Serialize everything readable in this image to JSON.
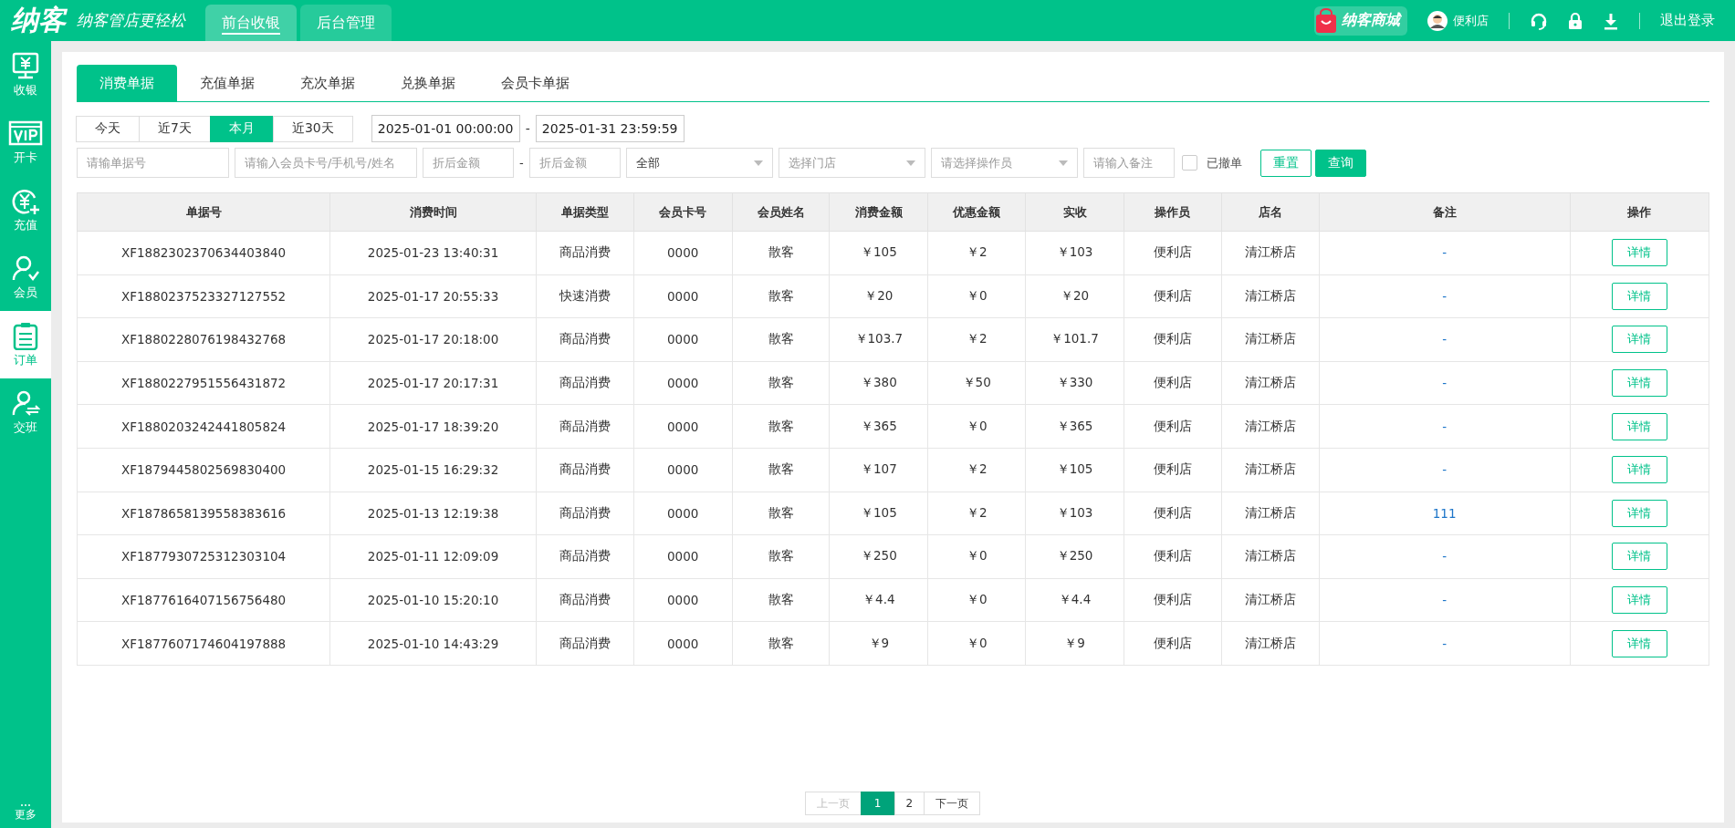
{
  "header": {
    "logo": "纳客",
    "slogan": "纳客管店更轻松",
    "nav_tabs": [
      {
        "label": "前台收银",
        "selected": true
      },
      {
        "label": "后台管理",
        "selected": false
      }
    ],
    "mall": "纳客商城",
    "user": "便利店",
    "logout": "退出登录"
  },
  "sidebar": {
    "items": [
      {
        "label": "收银",
        "kind": "cashier",
        "selected": false
      },
      {
        "label": "开卡",
        "kind": "vip",
        "selected": false
      },
      {
        "label": "充值",
        "kind": "recharge",
        "selected": false
      },
      {
        "label": "会员",
        "kind": "member",
        "selected": false
      },
      {
        "label": "订单",
        "kind": "order",
        "selected": true
      },
      {
        "label": "交班",
        "kind": "shift",
        "selected": false
      }
    ],
    "more": "更多"
  },
  "tabs": [
    {
      "label": "消费单据",
      "selected": true
    },
    {
      "label": "充值单据",
      "selected": false
    },
    {
      "label": "充次单据",
      "selected": false
    },
    {
      "label": "兑换单据",
      "selected": false
    },
    {
      "label": "会员卡单据",
      "selected": false
    }
  ],
  "date_presets": [
    {
      "label": "今天",
      "selected": false
    },
    {
      "label": "近7天",
      "selected": false
    },
    {
      "label": "本月",
      "selected": true
    },
    {
      "label": "近30天",
      "selected": false
    }
  ],
  "date_from": "2025-01-01 00:00:00",
  "date_sep": "-",
  "date_to": "2025-01-31 23:59:59",
  "filters": {
    "order_no": {
      "placeholder": "请输单据号"
    },
    "member": {
      "placeholder": "请输入会员卡号/手机号/姓名"
    },
    "amount_min": {
      "placeholder": "折后金额"
    },
    "amount_sep": "-",
    "amount_max": {
      "placeholder": "折后金额"
    },
    "type": {
      "value": "全部"
    },
    "store": {
      "placeholder": "选择门店"
    },
    "operator": {
      "placeholder": "请选择操作员"
    },
    "remark": {
      "placeholder": "请输入备注"
    },
    "revoked": {
      "label": "已撤单",
      "checked": false
    },
    "reset": "重置",
    "query": "查询"
  },
  "table": {
    "columns": [
      "单据号",
      "消费时间",
      "单据类型",
      "会员卡号",
      "会员姓名",
      "消费金额",
      "优惠金额",
      "实收",
      "操作员",
      "店名",
      "备注",
      "操作"
    ],
    "rows": [
      [
        "XF1882302370634403840",
        "2025-01-23 13:40:31",
        "商品消费",
        "0000",
        "散客",
        "￥105",
        "￥2",
        "￥103",
        "便利店",
        "清江桥店",
        "-",
        "详情"
      ],
      [
        "XF1880237523327127552",
        "2025-01-17 20:55:33",
        "快速消费",
        "0000",
        "散客",
        "￥20",
        "￥0",
        "￥20",
        "便利店",
        "清江桥店",
        "-",
        "详情"
      ],
      [
        "XF1880228076198432768",
        "2025-01-17 20:18:00",
        "商品消费",
        "0000",
        "散客",
        "￥103.7",
        "￥2",
        "￥101.7",
        "便利店",
        "清江桥店",
        "-",
        "详情"
      ],
      [
        "XF1880227951556431872",
        "2025-01-17 20:17:31",
        "商品消费",
        "0000",
        "散客",
        "￥380",
        "￥50",
        "￥330",
        "便利店",
        "清江桥店",
        "-",
        "详情"
      ],
      [
        "XF1880203242441805824",
        "2025-01-17 18:39:20",
        "商品消费",
        "0000",
        "散客",
        "￥365",
        "￥0",
        "￥365",
        "便利店",
        "清江桥店",
        "-",
        "详情"
      ],
      [
        "XF1879445802569830400",
        "2025-01-15 16:29:32",
        "商品消费",
        "0000",
        "散客",
        "￥107",
        "￥2",
        "￥105",
        "便利店",
        "清江桥店",
        "-",
        "详情"
      ],
      [
        "XF1878658139558383616",
        "2025-01-13 12:19:38",
        "商品消费",
        "0000",
        "散客",
        "￥105",
        "￥2",
        "￥103",
        "便利店",
        "清江桥店",
        "111",
        "详情"
      ],
      [
        "XF1877930725312303104",
        "2025-01-11 12:09:09",
        "商品消费",
        "0000",
        "散客",
        "￥250",
        "￥0",
        "￥250",
        "便利店",
        "清江桥店",
        "-",
        "详情"
      ],
      [
        "XF1877616407156756480",
        "2025-01-10 15:20:10",
        "商品消费",
        "0000",
        "散客",
        "￥4.4",
        "￥0",
        "￥4.4",
        "便利店",
        "清江桥店",
        "-",
        "详情"
      ],
      [
        "XF1877607174604197888",
        "2025-01-10 14:43:29",
        "商品消费",
        "0000",
        "散客",
        "￥9",
        "￥0",
        "￥9",
        "便利店",
        "清江桥店",
        "-",
        "详情"
      ]
    ]
  },
  "pagination": {
    "prev": {
      "label": "上一页",
      "disabled": true
    },
    "pages": [
      {
        "label": "1",
        "selected": true
      },
      {
        "label": "2",
        "selected": false
      }
    ],
    "next": {
      "label": "下一页",
      "disabled": false
    }
  }
}
